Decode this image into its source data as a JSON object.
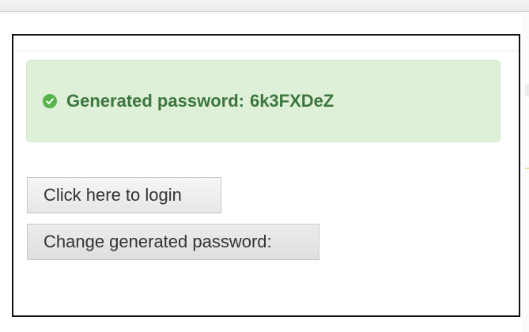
{
  "alert": {
    "icon": "check-circle-icon",
    "label": "Generated password:",
    "password": "6k3FXDeZ",
    "background_color": "#dff0d8",
    "text_color": "#3c763d",
    "icon_color": "#56b44a"
  },
  "buttons": {
    "login_label": "Click here to login",
    "change_password_label": "Change generated password:"
  }
}
